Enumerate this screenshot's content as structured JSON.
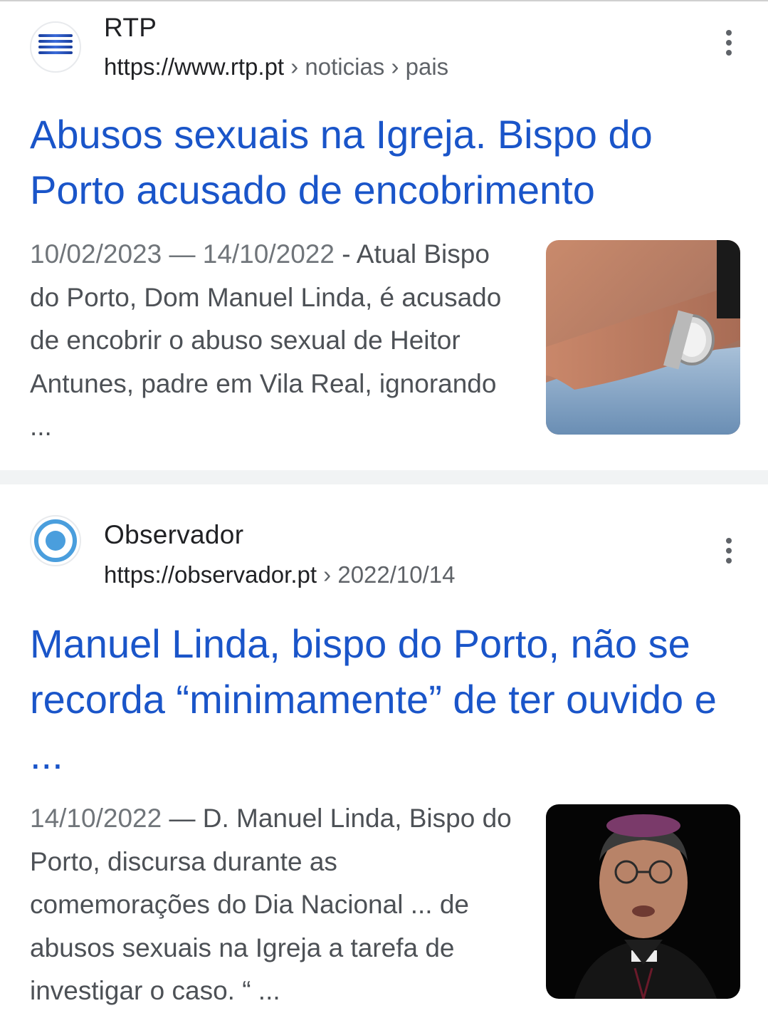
{
  "results": [
    {
      "site_name": "RTP",
      "url_base": "https://www.rtp.pt",
      "url_crumbs": " › noticias › pais",
      "title": "Abusos sexuais na Igreja. Bispo do Porto acusado de encobrimento",
      "date": "10/02/2023 — 14/10/2022",
      "snippet": " - Atual Bispo do Porto, Dom Manuel Linda, é acusado de encobrir o abuso sexual de Heitor Antunes, padre em Vila Real, ignorando ...",
      "favicon_icon": "rtp-logo-icon",
      "thumbnail": "hand-with-wristwatch-photo"
    },
    {
      "site_name": "Observador",
      "url_base": "https://observador.pt",
      "url_crumbs": " › 2022/10/14",
      "title": "Manuel Linda, bispo do Porto, não se recorda “minimamente” de ter ouvido e ...",
      "date": "14/10/2022",
      "snippet": " — D. Manuel Linda, Bispo do Porto, discursa durante as comemorações do Dia Nacional ... de abusos sexuais na Igreja a tarefa de investigar o caso. “ ...",
      "favicon_icon": "observador-logo-icon",
      "thumbnail": "bishop-portrait-photo"
    }
  ],
  "colors": {
    "title_link": "#1a55c9",
    "snippet": "#4d5156",
    "divider": "#f1f3f4"
  }
}
